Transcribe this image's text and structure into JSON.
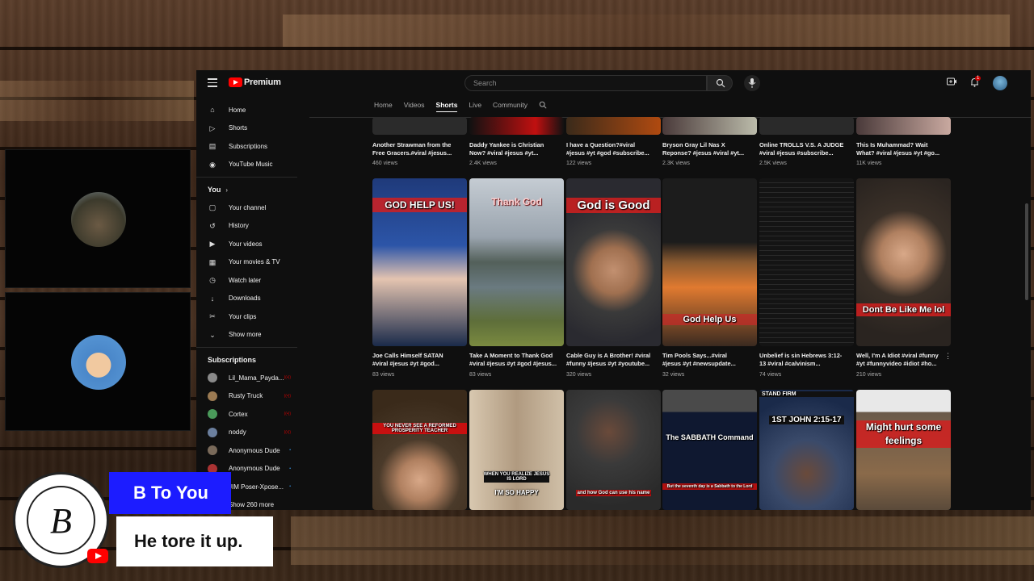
{
  "youtube": {
    "brand": "Premium",
    "search_placeholder": "Search",
    "notification_count": "1"
  },
  "sidebar": {
    "main": [
      {
        "label": "Home",
        "icon": "home-icon"
      },
      {
        "label": "Shorts",
        "icon": "shorts-icon"
      },
      {
        "label": "Subscriptions",
        "icon": "subscriptions-icon"
      },
      {
        "label": "YouTube Music",
        "icon": "music-icon"
      }
    ],
    "you_heading": "You",
    "you": [
      {
        "label": "Your channel",
        "icon": "channel-icon"
      },
      {
        "label": "History",
        "icon": "history-icon"
      },
      {
        "label": "Your videos",
        "icon": "videos-icon"
      },
      {
        "label": "Your movies & TV",
        "icon": "movies-icon"
      },
      {
        "label": "Watch later",
        "icon": "clock-icon"
      },
      {
        "label": "Downloads",
        "icon": "download-icon"
      },
      {
        "label": "Your clips",
        "icon": "scissors-icon"
      },
      {
        "label": "Show more",
        "icon": "chevron-down-icon"
      }
    ],
    "subs_heading": "Subscriptions",
    "subscriptions": [
      {
        "label": "Lil_Mama_Payda...",
        "color": "#8a8a8a",
        "live": "((•))"
      },
      {
        "label": "Rusty Truck",
        "color": "#9b7a52",
        "live": "((•))"
      },
      {
        "label": "Cortex",
        "color": "#4a9a5a",
        "live": "((•))"
      },
      {
        "label": "noddy",
        "color": "#6b7f9e",
        "live": "((•))"
      },
      {
        "label": "Anonymous Dude",
        "color": "#7a6a5a",
        "live": "•"
      },
      {
        "label": "Anonymous Dude",
        "color": "#a33",
        "live": "•"
      },
      {
        "label": "JIM Poser-Xpose...",
        "color": "#555",
        "live": "•"
      }
    ],
    "show_more_subs": "Show 260 more"
  },
  "tabs": [
    "Home",
    "Videos",
    "Shorts",
    "Live",
    "Community"
  ],
  "active_tab": "Shorts",
  "shorts_rows": [
    {
      "items": [
        {
          "title1": "Another Strawman from the",
          "title2": "Free Gracers.#viral #jesus...",
          "views": "460 views",
          "bg": "#2b2b2b"
        },
        {
          "title1": "Daddy Yankee is Christian",
          "title2": "Now? #viral #jesus #yt...",
          "views": "2.4K views",
          "bg": "#1a1a1a"
        },
        {
          "title1": "I have a Question?#viral",
          "title2": "#jesus #yt #god #subscribe...",
          "views": "122 views",
          "bg": "#3a2a1a"
        },
        {
          "title1": "Bryson Gray Lil Nas X",
          "title2": "Reponse? #jesus #viral #yt...",
          "views": "2.3K views",
          "bg": "#4a3a3a"
        },
        {
          "title1": "Online TROLLS V.S. A JUDGE",
          "title2": "#viral #jesus #subscribe...",
          "views": "2.5K views",
          "bg": "#2a2a2a"
        },
        {
          "title1": "This Is Muhammad? Wait",
          "title2": "What? #viral #jesus #yt #go...",
          "views": "11K views",
          "bg": "#4a3a3a"
        }
      ]
    },
    {
      "items": [
        {
          "title1": "Joe Calls Himself SATAN",
          "title2": "#viral #jesus #yt #god...",
          "views": "83 views",
          "overlay": "GOD HELP US!",
          "bg": "#1f3a7a"
        },
        {
          "title1": "Take A Moment to Thank God",
          "title2": "#viral #jesus #yt #god #jesus...",
          "views": "83 views",
          "overlay": "Thank God",
          "bg": "#6e7c8a"
        },
        {
          "title1": "Cable Guy is A Brother! #viral",
          "title2": "#funny #jesus #yt #youtube...",
          "views": "320 views",
          "overlay": "God is Good",
          "bg": "#3a3a3a"
        },
        {
          "title1": "Tim Pools Says...#viral",
          "title2": "#jesus #yt #newsupdate...",
          "views": "32 views",
          "overlay": "God Help Us",
          "bg": "#222"
        },
        {
          "title1": "Unbelief is sin Hebrews 3:12-",
          "title2": "13 #viral #calvinism...",
          "views": "74 views",
          "overlay": "",
          "bg": "#141414"
        },
        {
          "title1": "Well, I'm A Idiot #viral #funny",
          "title2": "#yt #funnyvideo #idiot #ho...",
          "views": "210 views",
          "overlay": "Dont Be Like Me lol",
          "bg": "#3a3028"
        }
      ]
    },
    {
      "items": [
        {
          "overlay": "YOU NEVER SEE A REFORMED PROSPERITY TEACHER",
          "bg": "#4a3a2a"
        },
        {
          "overlay": "WHEN YOU REALIZE JESUS IS LORD",
          "sub": "I'M SO HAPPY",
          "bg": "#c9b9a0"
        },
        {
          "overlay": "and how God can use his name",
          "bg": "#3a3a3a"
        },
        {
          "overlay": "The SABBATH Command",
          "sub": "But the seventh day is a Sabbath to the Lord",
          "bg": "#0f1830"
        },
        {
          "overlay": "1ST JOHN 2:15-17",
          "sub": "STAND FIRM",
          "bg": "#3a4a6a"
        },
        {
          "overlay": "Might hurt some feelings",
          "bg": "#5a4a3a"
        }
      ]
    }
  ],
  "stream": {
    "name": "B To You",
    "caption": "He tore it up.",
    "seal_letter": "B"
  }
}
